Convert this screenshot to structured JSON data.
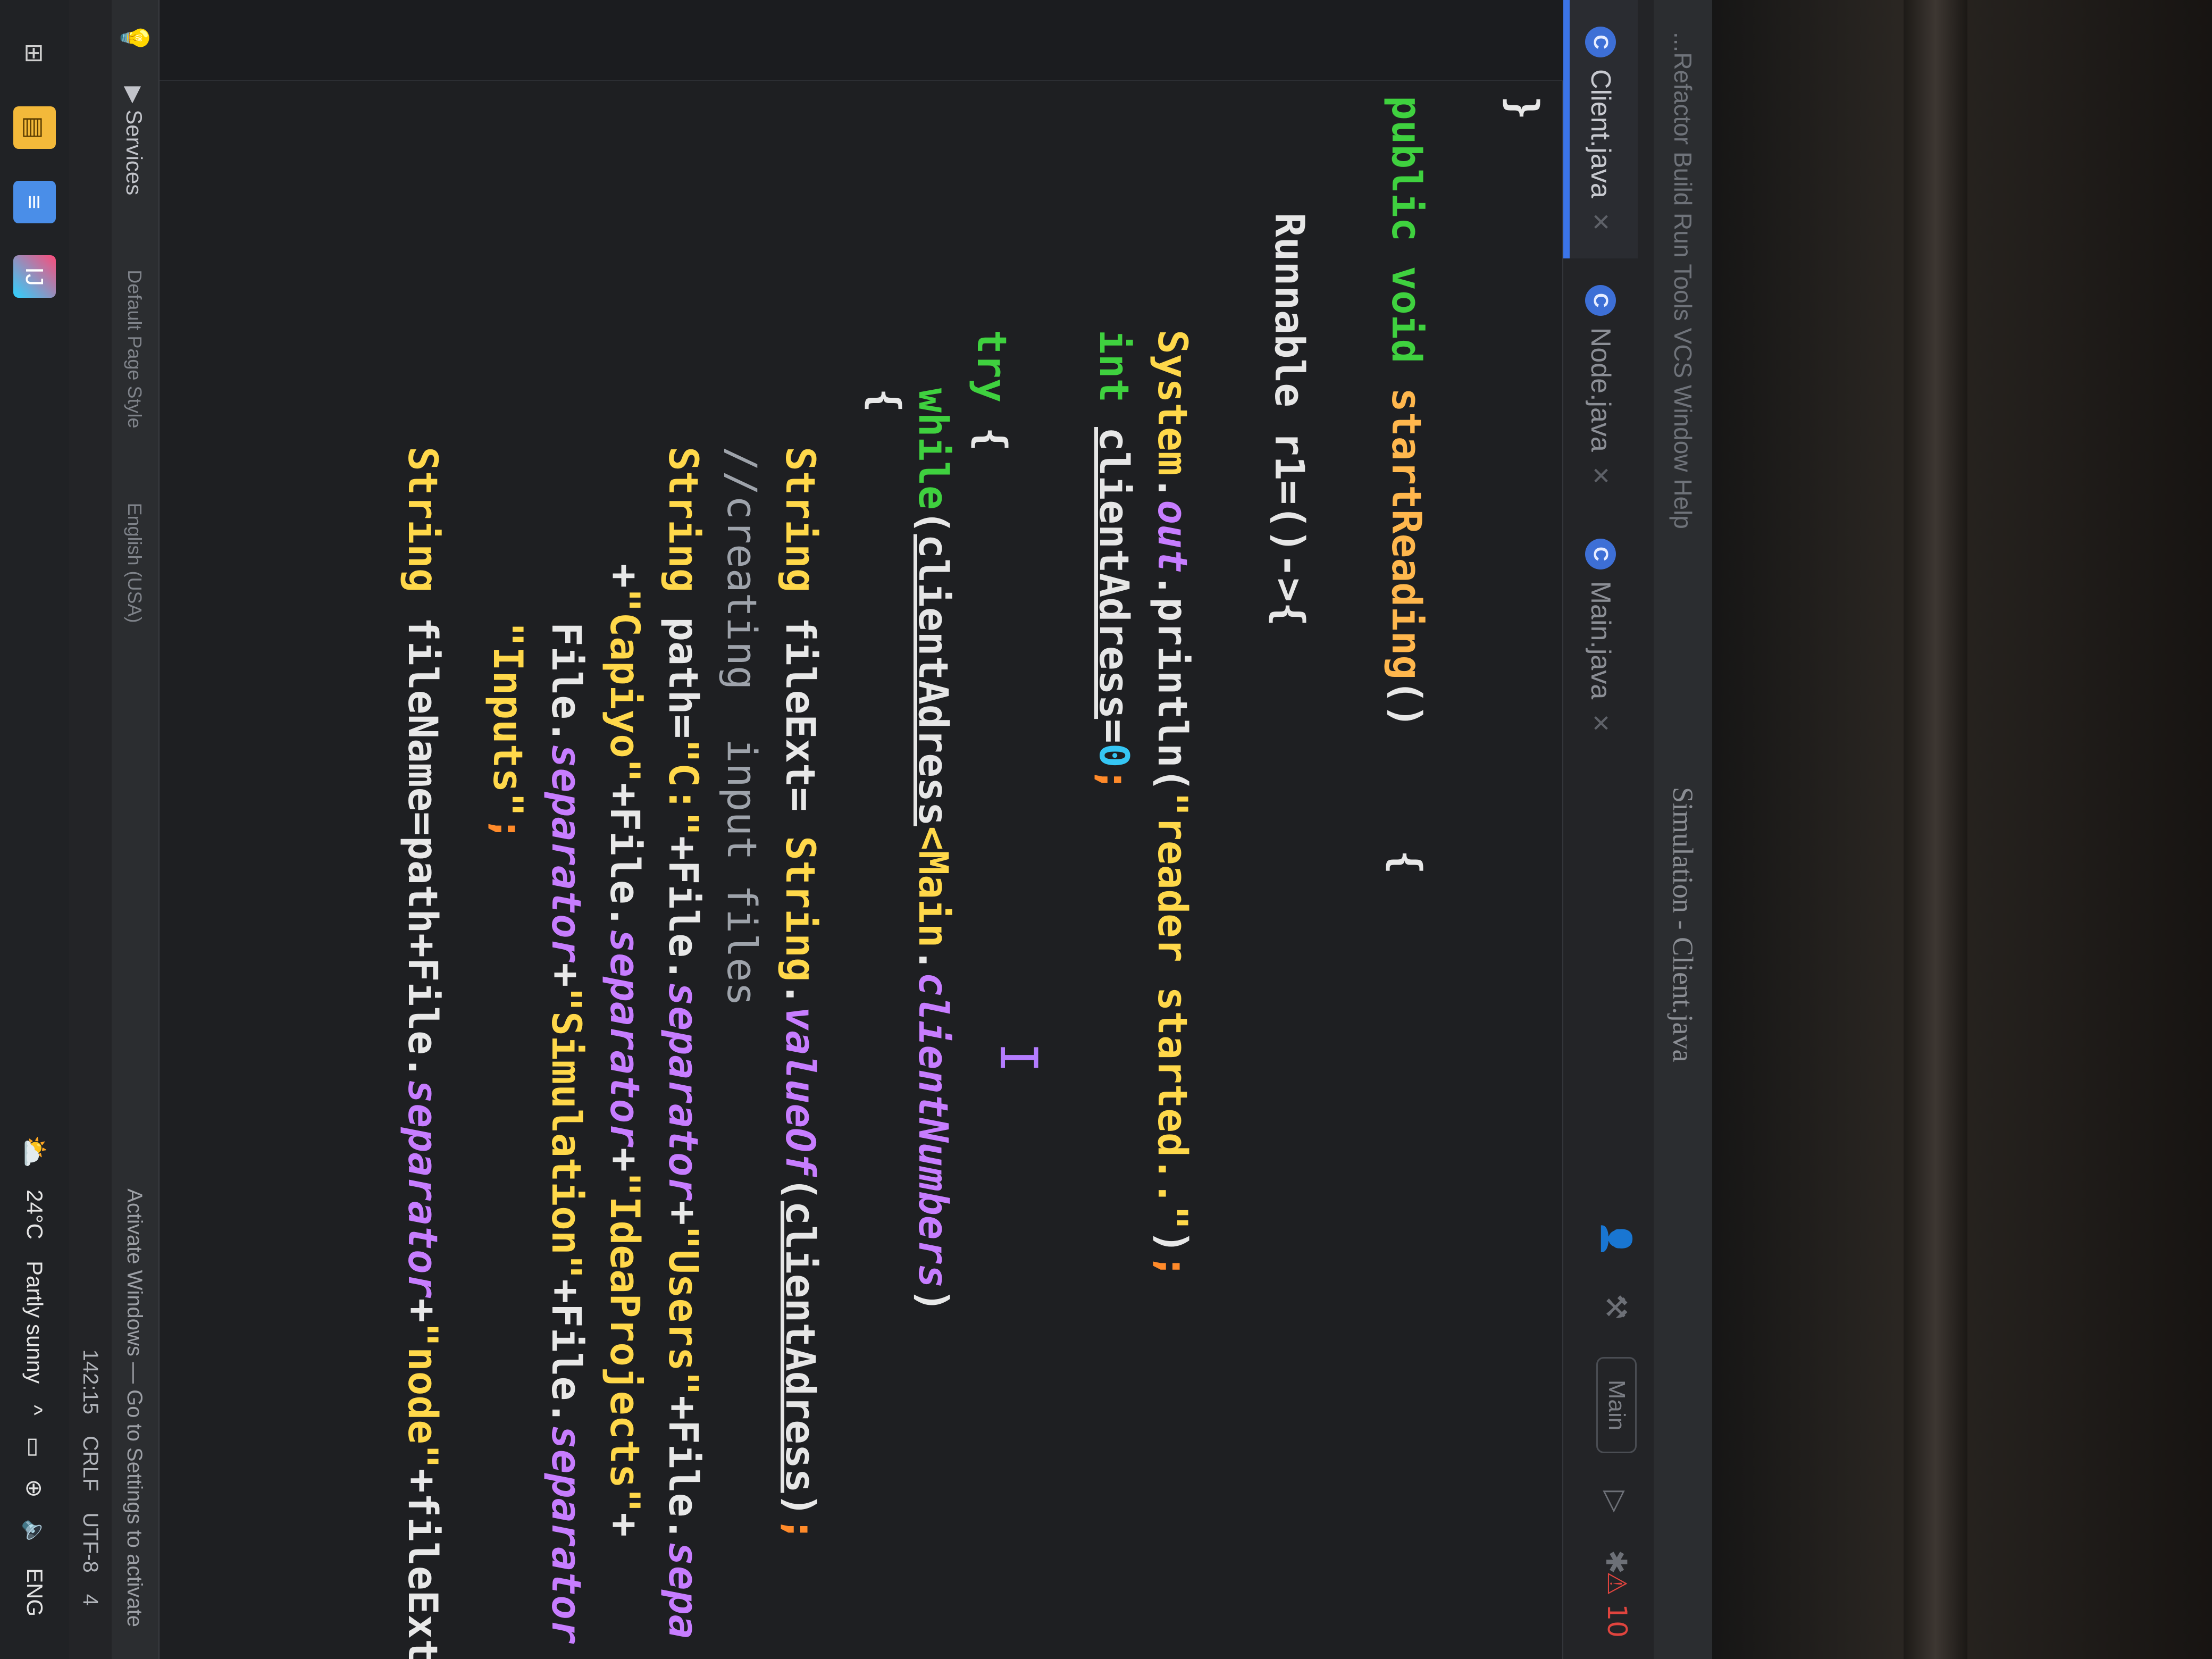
{
  "menu": {
    "items_text": "...Refactor  Build  Run  Tools  VCS  Window  Help"
  },
  "window_title": "Simulation - Client.java",
  "tabs": [
    {
      "label": "Client.java",
      "icon": "C",
      "active": true
    },
    {
      "label": "Node.java",
      "icon": "C",
      "active": false
    },
    {
      "label": "Main.java",
      "icon": "C",
      "active": false
    }
  ],
  "toolbar": {
    "run_config": "Main",
    "warning_count": "10"
  },
  "code": {
    "l0": "}",
    "l1_kw": "public void ",
    "l1_fn": "startReading",
    "l1_rest": "()     {",
    "l2": "Runnable r1=()->{",
    "l3_cls": "System",
    "l3_dot1": ".",
    "l3_fld": "out",
    "l3_call": ".println(",
    "l3_str": "\"reader started..\"",
    "l3_end": ")",
    "l3_semi": ";",
    "l4_kw": "int ",
    "l4_ident": "clientAdress",
    "l4_eq": "=",
    "l4_num": "0",
    "l4_semi": ";",
    "l5_kw": "try",
    "l5_rest": " {",
    "l6_kw": "while",
    "l6_open": "(",
    "l6_ident": "clientAdress",
    "l6_lt": "<",
    "l6_cls": "Main",
    "l6_dot": ".",
    "l6_fld": "clientNumbers",
    "l6_close": ")",
    "l7": "{",
    "l8_cls": "String",
    "l8_a": " fileExt= ",
    "l8_cls2": "String",
    "l8_dot": ".",
    "l8_call": "valueOf",
    "l8_open": "(",
    "l8_ident": "clientAdress",
    "l8_close": ")",
    "l8_semi": ";",
    "l9": "//creating  input files",
    "l10_cls": "String",
    "l10_a": " path=",
    "l10_s1": "\"C:\"",
    "l10_b": "+File.",
    "l10_f1": "separator",
    "l10_c": "+",
    "l10_s2": "\"Users\"",
    "l10_d": "+File.",
    "l10_f2": "sepa",
    "l11_a": "+",
    "l11_s1": "\"Capiyo\"",
    "l11_b": "+File.",
    "l11_f1": "separator",
    "l11_c": "+",
    "l11_s2": "\"IdeaProjects\"",
    "l11_d": "+",
    "l12_a": "File.",
    "l12_f1": "separator",
    "l12_b": "+",
    "l12_s1": "\"Simulation\"",
    "l12_c": "+File.",
    "l12_f2": "separator",
    "l13_s1": "\"Inputs\"",
    "l13_semi": ";",
    "l14_cls": "String",
    "l14_a": " fileName=path+File.",
    "l14_f1": "separator",
    "l14_b": "+",
    "l14_s1": "\"node\"",
    "l14_c": "+fileExt"
  },
  "services_panel": {
    "label": "Services",
    "left_text": "Default Page Style",
    "lang_text": "English (USA)"
  },
  "activate_windows": {
    "title": "Activate Windows",
    "subtitle": "Go to Settings to activate"
  },
  "status": {
    "position": "142:15",
    "line_ending": "CRLF",
    "encoding": "UTF-8",
    "indent": "4"
  },
  "taskbar": {
    "temperature": "24°C",
    "weather": "Partly sunny",
    "language": "ENG"
  },
  "icons": {
    "start": "start-menu-icon",
    "explorer": "file-explorer-icon",
    "notepad": "notepad-icon",
    "intellij": "intellij-idea-icon",
    "weather": "partly-sunny-icon",
    "wifi": "network-icon",
    "volume": "volume-icon",
    "battery": "battery-icon"
  },
  "colors": {
    "keyword": "#3fd13f",
    "method": "#ffb74d",
    "string": "#ffd84a",
    "field": "#c77dff",
    "number": "#35c6f4",
    "active_tab_underline": "#3b74e8"
  }
}
